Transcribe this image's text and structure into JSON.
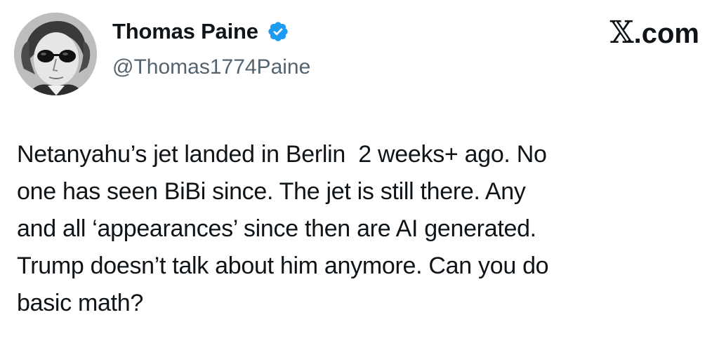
{
  "author": {
    "display_name": "Thomas Paine",
    "handle": "@Thomas1774Paine",
    "verified": true,
    "avatar_icon": "avatar-portrait-sunglasses"
  },
  "brand": {
    "label": ".com",
    "logo_icon": "x-logo"
  },
  "tweet": {
    "text": "Netanyahu’s jet landed in Berlin  2 weeks+ ago. No\none has seen BiBi since. The jet is still there. Any\nand all ‘appearances’ since then are AI generated.\nTrump doesn’t talk about him anymore. Can you do\nbasic math?"
  },
  "colors": {
    "text": "#0f1419",
    "handle": "#536471",
    "verified_badge": "#1d9bf0",
    "background": "#ffffff"
  }
}
